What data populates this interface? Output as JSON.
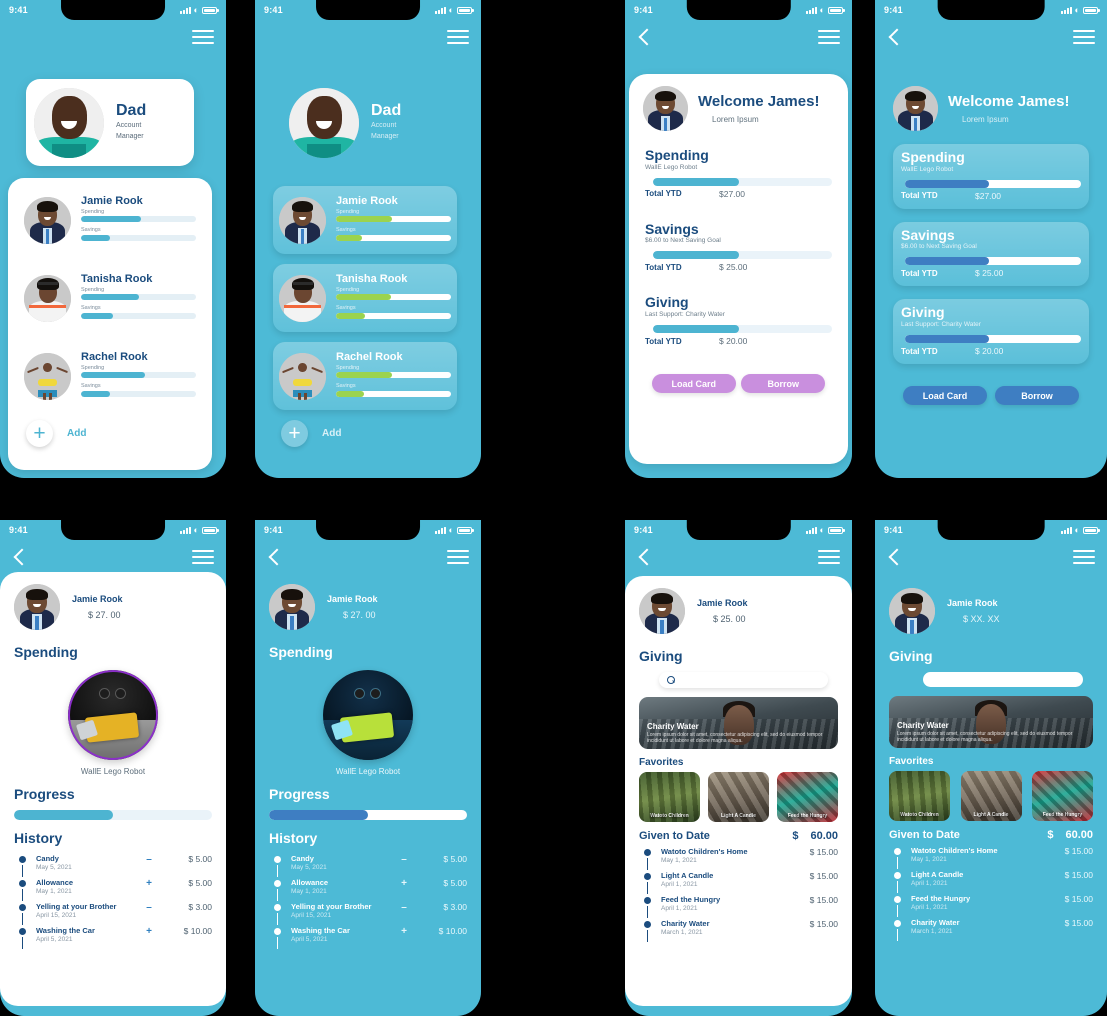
{
  "status_bar": {
    "time": "9:41",
    "icons": [
      "signal-icon",
      "wifi-icon",
      "battery-icon"
    ]
  },
  "colors": {
    "brand_blue": "#4DBAD6",
    "deep_blue": "#1B4C7E",
    "bar_fill_blue": "#4DB4D1",
    "bar_fill_green": "#9BD34F",
    "bar_fill_darkblue": "#3E7EC2",
    "cta_purple": "#C98FDE",
    "cta_blue": "#3E7EC2"
  },
  "screens": {
    "profile_light": {
      "account": {
        "name": "Dad",
        "role_line1": "Account",
        "role_line2": "Manager"
      },
      "kids": [
        {
          "name": "Jamie Rook",
          "bars": [
            {
              "label": "Spending",
              "percent": 52
            },
            {
              "label": "Savings",
              "percent": 25
            }
          ]
        },
        {
          "name": "Tanisha Rook",
          "bars": [
            {
              "label": "Spending",
              "percent": 50
            },
            {
              "label": "Savings",
              "percent": 28
            }
          ]
        },
        {
          "name": "Rachel Rook",
          "bars": [
            {
              "label": "Spending",
              "percent": 56
            },
            {
              "label": "Savings",
              "percent": 25
            }
          ]
        }
      ],
      "add_label": "Add",
      "add_icon": "plus-icon"
    },
    "profile_dark": {
      "account": {
        "name": "Dad",
        "role_line1": "Account",
        "role_line2": "Manager"
      },
      "kids": [
        {
          "name": "Jamie Rook",
          "bars": [
            {
              "label": "Spending",
              "percent": 49
            },
            {
              "label": "Savings",
              "percent": 23
            }
          ]
        },
        {
          "name": "Tanisha Rook",
          "bars": [
            {
              "label": "Spending",
              "percent": 48
            },
            {
              "label": "Savings",
              "percent": 25
            }
          ]
        },
        {
          "name": "Rachel Rook",
          "bars": [
            {
              "label": "Spending",
              "percent": 49
            },
            {
              "label": "Savings",
              "percent": 24
            }
          ]
        }
      ],
      "add_label": "Add",
      "add_icon": "plus-icon"
    },
    "welcome_light": {
      "title": "Welcome James!",
      "subtitle": "Lorem Ipsum",
      "accounts": [
        {
          "title": "Spending",
          "subtitle": "WallE Lego Robot",
          "percent": 48,
          "ytd_label": "Total YTD",
          "ytd_value": "$27.00"
        },
        {
          "title": "Savings",
          "subtitle": "$6.00 to Next Saving Goal",
          "percent": 48,
          "ytd_label": "Total YTD",
          "ytd_value": "$  25.00"
        },
        {
          "title": "Giving",
          "subtitle": "Last Support: Charity Water",
          "percent": 48,
          "ytd_label": "Total YTD",
          "ytd_value": "$ 20.00"
        }
      ],
      "buttons": [
        "Load Card",
        "Borrow"
      ]
    },
    "welcome_dark": {
      "title": "Welcome James!",
      "subtitle": "Lorem Ipsum",
      "accounts": [
        {
          "title": "Spending",
          "subtitle": "WallE Lego Robot",
          "percent": 48,
          "ytd_label": "Total YTD",
          "ytd_value": "$27.00"
        },
        {
          "title": "Savings",
          "subtitle": "$6.00 to Next Saving Goal",
          "percent": 48,
          "ytd_label": "Total YTD",
          "ytd_value": "$  25.00"
        },
        {
          "title": "Giving",
          "subtitle": "Last Support: Charity Water",
          "percent": 48,
          "ytd_label": "Total YTD",
          "ytd_value": "$ 20.00"
        }
      ],
      "buttons": [
        "Load Card",
        "Borrow"
      ]
    },
    "spending_light": {
      "user": {
        "name": "Jamie Rook",
        "amount": "$ 27. 00"
      },
      "section_title": "Spending",
      "product_caption": "WallE Lego Robot",
      "progress_label": "Progress",
      "progress_percent": 50,
      "history_label": "History",
      "history": [
        {
          "title": "Candy",
          "date": "May 5, 2021",
          "sign": "–",
          "amount": "$  5.00"
        },
        {
          "title": "Allowance",
          "date": "May 1, 2021",
          "sign": "+",
          "amount": "$  5.00"
        },
        {
          "title": "Yelling at your Brother",
          "date": "April 15, 2021",
          "sign": "–",
          "amount": "$  3.00"
        },
        {
          "title": "Washing the Car",
          "date": "April 5, 2021",
          "sign": "+",
          "amount": "$ 10.00"
        }
      ]
    },
    "spending_dark": {
      "user": {
        "name": "Jamie Rook",
        "amount": "$ 27. 00"
      },
      "section_title": "Spending",
      "product_caption": "WallE Lego Robot",
      "progress_label": "Progress",
      "progress_percent": 50,
      "history_label": "History",
      "history": [
        {
          "title": "Candy",
          "date": "May 5, 2021",
          "sign": "–",
          "amount": "$  5.00"
        },
        {
          "title": "Allowance",
          "date": "May 1, 2021",
          "sign": "+",
          "amount": "$  5.00"
        },
        {
          "title": "Yelling at your Brother",
          "date": "April 15, 2021",
          "sign": "–",
          "amount": "$  3.00"
        },
        {
          "title": "Washing the Car",
          "date": "April 5, 2021",
          "sign": "+",
          "amount": "$ 10.00"
        }
      ]
    },
    "giving_light": {
      "user": {
        "name": "Jamie Rook",
        "amount": "$ 25. 00"
      },
      "section_title": "Giving",
      "search_placeholder": "",
      "search_icon": "search-icon",
      "hero": {
        "title": "Charity Water",
        "description": "Lorem ipsum dolor sit amet, consectetur adipiscing elit, sed do eiusmod tempor incididunt ut labore et dolore magna aliqua."
      },
      "favorites_label": "Favorites",
      "favorites": [
        "Watoto Children",
        "Light A Candle",
        "Feed the Hungry"
      ],
      "given_label": "Given to Date",
      "given_currency": "$",
      "given_value": "60.00",
      "donations": [
        {
          "title": "Watoto Children's Home",
          "date": "May 1, 2021",
          "amount": "$ 15.00"
        },
        {
          "title": "Light A Candle",
          "date": "April 1, 2021",
          "amount": "$ 15.00"
        },
        {
          "title": "Feed the Hungry",
          "date": "April 1, 2021",
          "amount": "$ 15.00"
        },
        {
          "title": "Charity Water",
          "date": "March 1, 2021",
          "amount": "$ 15.00"
        }
      ]
    },
    "giving_dark": {
      "user": {
        "name": "Jamie Rook",
        "amount": "$ XX. XX"
      },
      "section_title": "Giving",
      "search_placeholder": "",
      "search_icon": "search-icon",
      "hero": {
        "title": "Charity Water",
        "description": "Lorem ipsum dolor sit amet, consectetur adipiscing elit, sed do eiusmod tempor incididunt ut labore et dolore magna aliqua."
      },
      "favorites_label": "Favorites",
      "favorites": [
        "Watoto Children",
        "Light A Candle",
        "Feed the Hungry"
      ],
      "given_label": "Given to Date",
      "given_currency": "$",
      "given_value": "60.00",
      "donations": [
        {
          "title": "Watoto Children's Home",
          "date": "May 1, 2021",
          "amount": "$ 15.00"
        },
        {
          "title": "Light A Candle",
          "date": "April 1, 2021",
          "amount": "$ 15.00"
        },
        {
          "title": "Feed the Hungry",
          "date": "April 1, 2021",
          "amount": "$ 15.00"
        },
        {
          "title": "Charity Water",
          "date": "March 1, 2021",
          "amount": "$ 15.00"
        }
      ]
    }
  }
}
